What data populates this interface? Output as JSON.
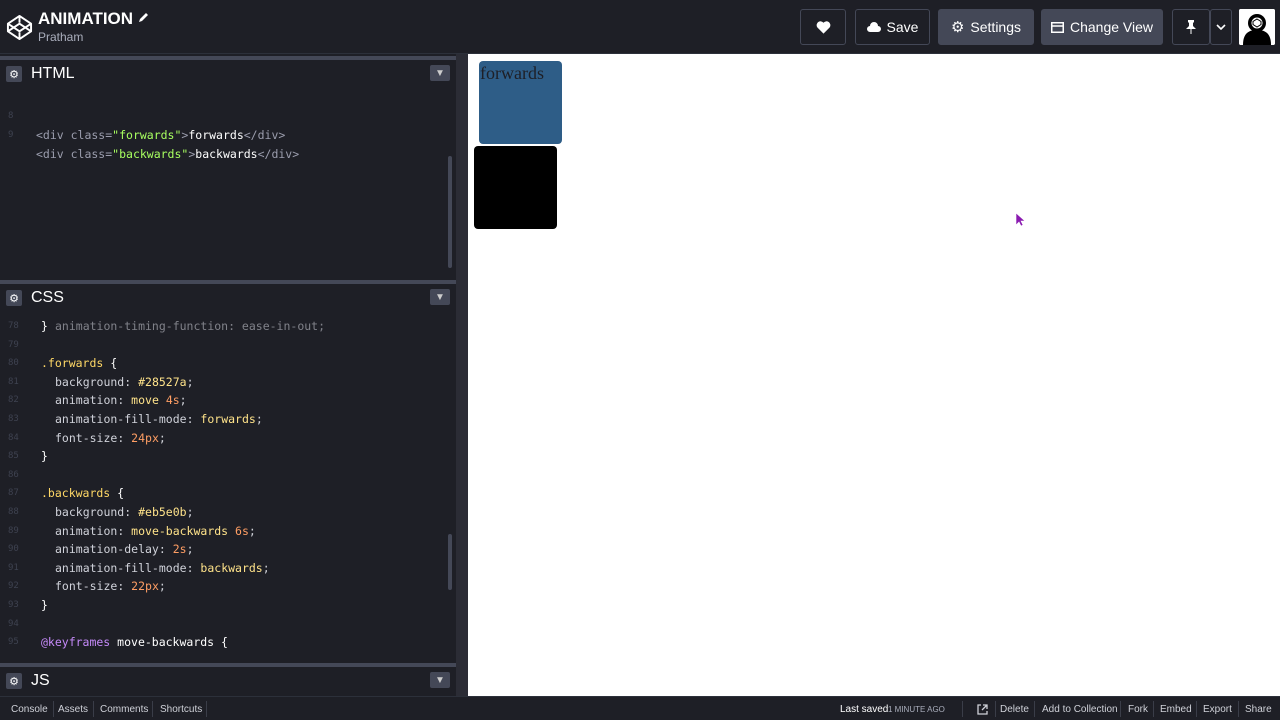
{
  "header": {
    "title": "ANIMATION",
    "user": "Pratham",
    "buttons": {
      "save": "Save",
      "settings": "Settings",
      "change_view": "Change View"
    }
  },
  "panels": {
    "html": {
      "label": "HTML"
    },
    "css": {
      "label": "CSS"
    },
    "js": {
      "label": "JS"
    }
  },
  "html_code": [
    {
      "n": "8",
      "pre": "<div class=",
      "attr": "\"forwards\"",
      "mid": ">",
      "text": "forwards",
      "post": "</div>"
    },
    {
      "n": "9",
      "pre": "<div class=",
      "attr": "\"backwards\"",
      "mid": ">",
      "text": "backwards",
      "post": "</div>"
    }
  ],
  "css_code": {
    "partial_top": "animation-timing-function: ease-in-out;",
    "lines": [
      {
        "n": "78",
        "text": "}"
      },
      {
        "n": "79",
        "text": ""
      },
      {
        "n": "80",
        "sel": ".forwards",
        "text": " {"
      },
      {
        "n": "81",
        "prop": "background",
        "val": "#28527a",
        "kind": "val"
      },
      {
        "n": "82",
        "prop": "animation",
        "val": "move",
        "num": "4s"
      },
      {
        "n": "83",
        "prop": "animation-fill-mode",
        "val": "forwards",
        "kind": "val"
      },
      {
        "n": "84",
        "prop": "font-size",
        "num": "24px"
      },
      {
        "n": "85",
        "text": "}"
      },
      {
        "n": "86",
        "text": ""
      },
      {
        "n": "87",
        "sel": ".backwards",
        "text": " {"
      },
      {
        "n": "88",
        "prop": "background",
        "val": "#eb5e0b",
        "kind": "val"
      },
      {
        "n": "89",
        "prop": "animation",
        "val": "move-backwards",
        "num": "6s"
      },
      {
        "n": "90",
        "prop": "animation-delay",
        "num": "2s"
      },
      {
        "n": "91",
        "prop": "animation-fill-mode",
        "val": "backwards",
        "kind": "val"
      },
      {
        "n": "92",
        "prop": "font-size",
        "num": "22px"
      },
      {
        "n": "93",
        "text": "}"
      },
      {
        "n": "94",
        "text": ""
      },
      {
        "n": "95",
        "at": "@keyframes",
        "text": " move-backwards {"
      }
    ]
  },
  "preview": {
    "forwards_text": "forwards"
  },
  "statusbar": {
    "console": "Console",
    "assets": "Assets",
    "comments": "Comments",
    "shortcuts": "Shortcuts",
    "last_saved_label": "Last saved",
    "last_saved_time": "1 MINUTE AGO",
    "delete": "Delete",
    "add_to_collection": "Add to Collection",
    "fork": "Fork",
    "embed": "Embed",
    "export": "Export",
    "share": "Share"
  },
  "colors": {
    "bg": "#1e1f26",
    "button_gray": "#444857",
    "forwards_box": "#2e5d87",
    "backwards_box": "#000000"
  }
}
